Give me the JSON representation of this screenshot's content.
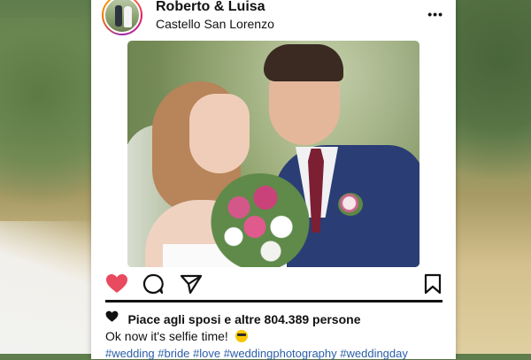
{
  "post": {
    "username": "Roberto & Luisa",
    "location": "Castello San Lorenzo",
    "more_label": "•••",
    "likes_text": "Piace agli sposi e altre 804.389 persone",
    "caption": "Ok now it's selfie time!",
    "hashtags": "#wedding #bride #love #weddingphotography #weddingday"
  },
  "colors": {
    "like_red": "#e84a5f",
    "hashtag_blue": "#2b5ea8",
    "frame_white": "#ffffff"
  },
  "icons": {
    "like": "heart-icon",
    "comment": "comment-icon",
    "share": "send-icon",
    "save": "bookmark-icon",
    "likes": "heart-icon",
    "caption_emoji": "sunglasses-emoji-icon"
  }
}
